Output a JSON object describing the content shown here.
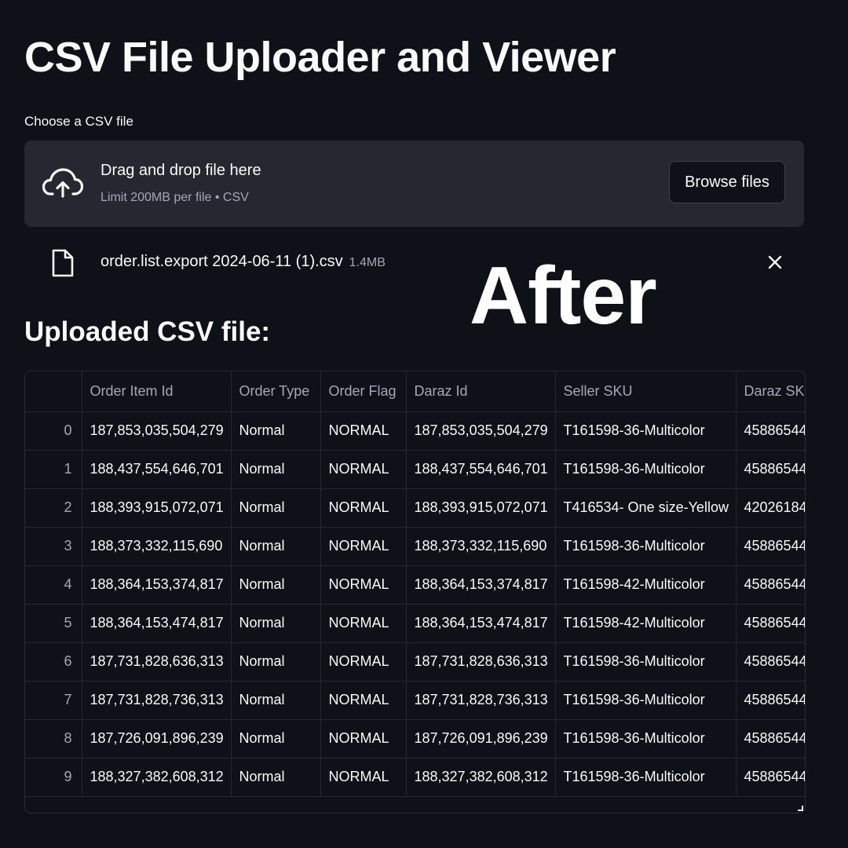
{
  "app": {
    "title": "CSV File Uploader and Viewer"
  },
  "uploader": {
    "label": "Choose a CSV file",
    "drop_text": "Drag and drop file here",
    "limit_text": "Limit 200MB per file • CSV",
    "browse_label": "Browse files",
    "icon": "cloud-upload-icon"
  },
  "file": {
    "name": "order.list.export 2024-06-11 (1).csv",
    "size": "1.4MB",
    "icon": "file-icon",
    "remove_icon": "close-icon"
  },
  "overlay_text": "After",
  "table": {
    "heading": "Uploaded CSV file:",
    "columns": [
      "",
      "Order Item Id",
      "Order Type",
      "Order Flag",
      "Daraz Id",
      "Seller SKU",
      "Daraz SKU"
    ],
    "rows": [
      [
        "0",
        "187,853,035,504,279",
        "Normal",
        "NORMAL",
        "187,853,035,504,279",
        "T161598-36-Multicolor",
        "45886544"
      ],
      [
        "1",
        "188,437,554,646,701",
        "Normal",
        "NORMAL",
        "188,437,554,646,701",
        "T161598-36-Multicolor",
        "45886544"
      ],
      [
        "2",
        "188,393,915,072,071",
        "Normal",
        "NORMAL",
        "188,393,915,072,071",
        "T416534- One size-Yellow",
        "42026184"
      ],
      [
        "3",
        "188,373,332,115,690",
        "Normal",
        "NORMAL",
        "188,373,332,115,690",
        "T161598-36-Multicolor",
        "45886544"
      ],
      [
        "4",
        "188,364,153,374,817",
        "Normal",
        "NORMAL",
        "188,364,153,374,817",
        "T161598-42-Multicolor",
        "45886544"
      ],
      [
        "5",
        "188,364,153,474,817",
        "Normal",
        "NORMAL",
        "188,364,153,474,817",
        "T161598-42-Multicolor",
        "45886544"
      ],
      [
        "6",
        "187,731,828,636,313",
        "Normal",
        "NORMAL",
        "187,731,828,636,313",
        "T161598-36-Multicolor",
        "45886544"
      ],
      [
        "7",
        "187,731,828,736,313",
        "Normal",
        "NORMAL",
        "187,731,828,736,313",
        "T161598-36-Multicolor",
        "45886544"
      ],
      [
        "8",
        "187,726,091,896,239",
        "Normal",
        "NORMAL",
        "187,726,091,896,239",
        "T161598-36-Multicolor",
        "45886544"
      ],
      [
        "9",
        "188,327,382,608,312",
        "Normal",
        "NORMAL",
        "188,327,382,608,312",
        "T161598-36-Multicolor",
        "45886544"
      ]
    ]
  },
  "colors": {
    "background": "#0e1117",
    "dropzone": "#262730",
    "text": "#fafafa",
    "muted": "#a3a8b8",
    "grid": "#262932"
  }
}
